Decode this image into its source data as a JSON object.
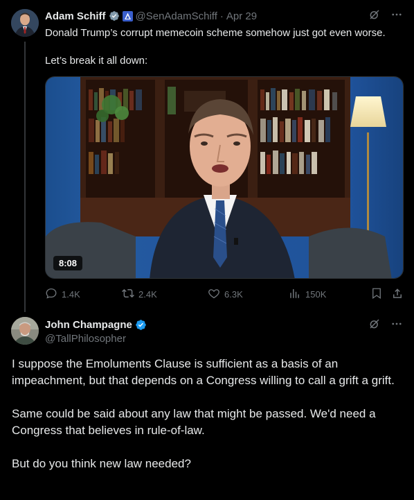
{
  "tweet": {
    "author_name": "Adam Schiff",
    "handle": "@SenAdamSchiff",
    "separator": "·",
    "date": "Apr 29",
    "text_lines": [
      "Donald Trump’s corrupt memecoin scheme somehow just got even worse.",
      "Let’s break it all down:"
    ],
    "video_duration": "8:08",
    "metrics": {
      "replies": "1.4K",
      "reposts": "2.4K",
      "likes": "6.3K",
      "views": "150K"
    }
  },
  "reply": {
    "author_name": "John Champagne",
    "handle": "@TallPhilosopher",
    "paragraphs": [
      "I suppose the Emoluments Clause is sufficient as a basis of an impeachment, but that depends on a Congress willing to call a grift a grift.",
      "Same could be said about any law that might be passed. We'd need a Congress that believes in rule-of-law.",
      "But do you think new law needed?"
    ]
  },
  "colors": {
    "background": "#000000",
    "text": "#e7e9ea",
    "muted": "#71767b",
    "verified_blue": "#1d9bf0",
    "verified_gray": "#829aab"
  },
  "icons": {
    "grok": "grok-icon",
    "more": "more-icon",
    "reply": "reply-icon",
    "repost": "repost-icon",
    "like": "heart-icon",
    "views": "views-icon",
    "bookmark": "bookmark-icon",
    "share": "share-icon"
  }
}
